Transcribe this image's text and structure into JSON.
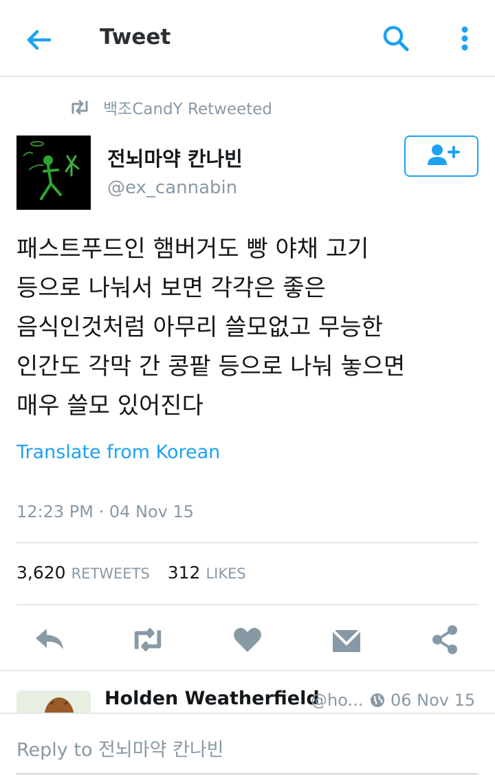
{
  "header": {
    "title": "Tweet",
    "back_icon": "arrow-left-icon",
    "search_icon": "search-icon",
    "more_icon": "more-vertical-icon"
  },
  "retweet_context": {
    "text": "백조CandY Retweeted",
    "icon": "retweet-icon"
  },
  "tweet": {
    "author_name": "전뇌마약 칸나빈",
    "author_handle": "@ex_cannabin",
    "text": "패스트푸드인 햄버거도 빵 야채 고기\n등으로 나눠서 보면 각각은 좋은\n음식인것처럼 아무리 쓸모없고 무능한\n인간도 각막 간 콩팥 등으로 나눠 놓으면\n매우 쓸모 있어진다",
    "translate_label": "Translate from Korean",
    "timestamp": "12:23 PM · 04 Nov 15",
    "retweets_count": "3,620",
    "retweets_label": "RETWEETS",
    "likes_count": "312",
    "likes_label": "LIKES"
  },
  "actions": [
    "reply-icon",
    "retweet-icon",
    "heart-icon",
    "direct-message-icon",
    "share-icon"
  ],
  "reply_preview": {
    "name": "Holden Weatherfield",
    "handle": "@ho...",
    "date": "06 Nov 15"
  },
  "reply_bar": {
    "placeholder": "Reply to 전뇌마약 칸나빈"
  },
  "colors": {
    "accent": "#1da1f2",
    "muted": "#8899a6",
    "divider": "#e1e8ed"
  }
}
